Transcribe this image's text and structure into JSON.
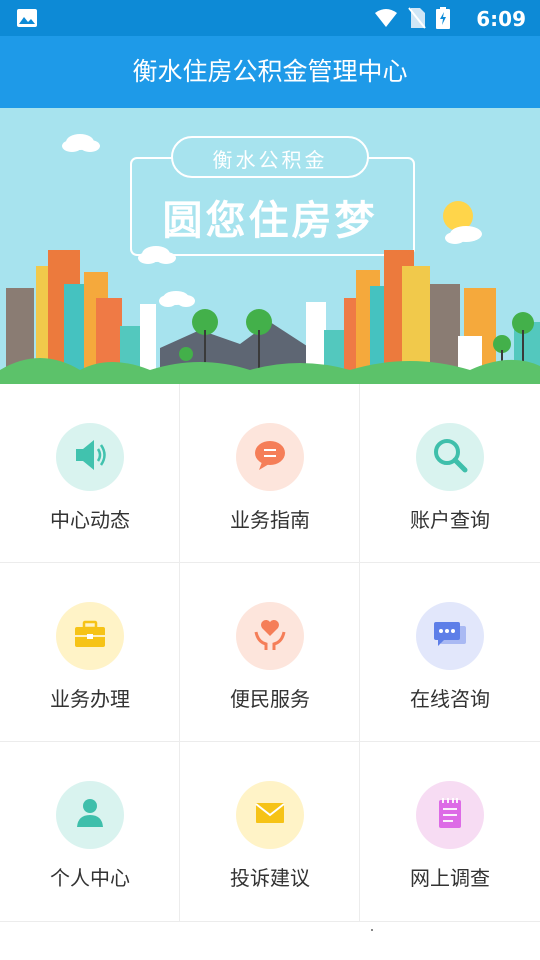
{
  "status_bar": {
    "time": "6:09"
  },
  "header": {
    "title": "衡水住房公积金管理中心"
  },
  "banner": {
    "subtitle": "衡水公积金",
    "slogan": "圆您住房梦"
  },
  "menu": [
    {
      "label": "中心动态",
      "icon": "speaker-icon",
      "bg": "#d9f3ef",
      "color": "#41c2ae"
    },
    {
      "label": "业务指南",
      "icon": "chat-bubble-icon",
      "bg": "#fde5dc",
      "color": "#f57e58"
    },
    {
      "label": "账户查询",
      "icon": "search-icon",
      "bg": "#d9f3ef",
      "color": "#3fbfab"
    },
    {
      "label": "业务办理",
      "icon": "briefcase-icon",
      "bg": "#fff3c7",
      "color": "#f6c317"
    },
    {
      "label": "便民服务",
      "icon": "heart-hands-icon",
      "bg": "#fde5dc",
      "color": "#f57e58"
    },
    {
      "label": "在线咨询",
      "icon": "message-icon",
      "bg": "#e2e7fb",
      "color": "#5e7fe8"
    },
    {
      "label": "个人中心",
      "icon": "person-icon",
      "bg": "#d9f3ef",
      "color": "#3fbfab"
    },
    {
      "label": "投诉建议",
      "icon": "envelope-icon",
      "bg": "#fff3c7",
      "color": "#f6c317"
    },
    {
      "label": "网上调查",
      "icon": "notepad-icon",
      "bg": "#f7dcf3",
      "color": "#dd6be6"
    }
  ]
}
